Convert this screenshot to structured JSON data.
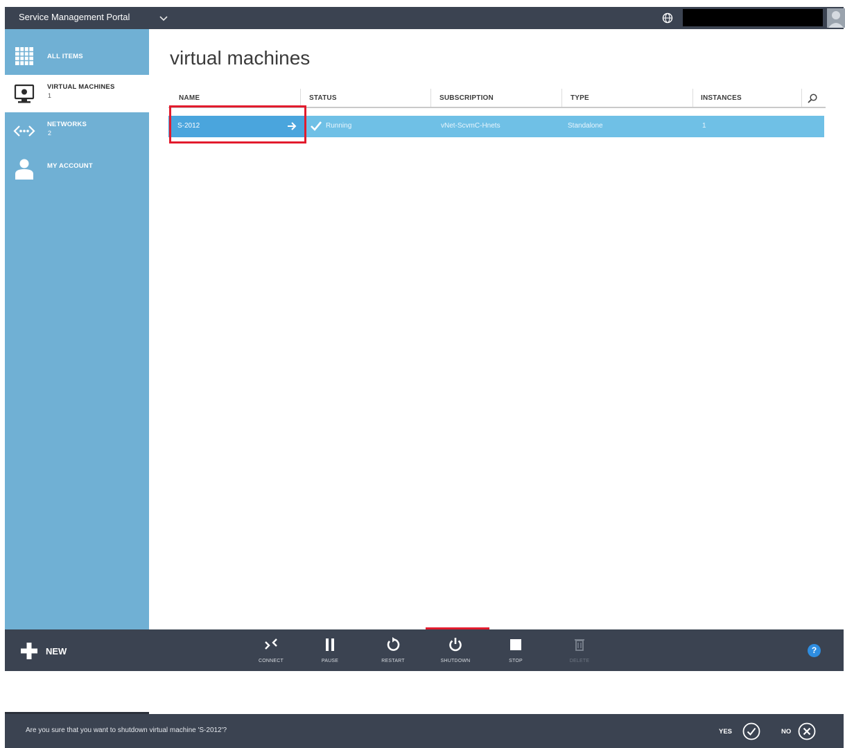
{
  "topbar": {
    "brand": "Service Management Portal",
    "chevron": "chevron-down-icon"
  },
  "sidebar": {
    "items": [
      {
        "label": "ALL ITEMS",
        "count": "",
        "icon": "grid-icon"
      },
      {
        "label": "VIRTUAL MACHINES",
        "count": "1",
        "icon": "monitor-icon",
        "selected": true
      },
      {
        "label": "NETWORKS",
        "count": "2",
        "icon": "network-icon"
      },
      {
        "label": "MY ACCOUNT",
        "count": "",
        "icon": "person-icon"
      }
    ]
  },
  "main": {
    "title": "virtual machines",
    "columns": [
      "NAME",
      "STATUS",
      "SUBSCRIPTION",
      "TYPE",
      "INSTANCES"
    ],
    "rows": [
      {
        "name": "S-2012",
        "status": "Running",
        "subscription": "vNet-ScvmC-Hnets",
        "type": "Standalone",
        "instances": "1"
      }
    ]
  },
  "commandbar": {
    "new_label": "NEW",
    "commands": [
      {
        "label": "CONNECT",
        "icon": "connect-icon",
        "enabled": true
      },
      {
        "label": "PAUSE",
        "icon": "pause-icon",
        "enabled": true
      },
      {
        "label": "RESTART",
        "icon": "restart-icon",
        "enabled": true
      },
      {
        "label": "SHUTDOWN",
        "icon": "power-icon",
        "enabled": true
      },
      {
        "label": "STOP",
        "icon": "stop-icon",
        "enabled": true
      },
      {
        "label": "DELETE",
        "icon": "trash-icon",
        "enabled": false
      }
    ],
    "help": "?"
  },
  "confirm": {
    "message": "Are you sure that you want to shutdown virtual machine 'S-2012'?",
    "yes_label": "YES",
    "no_label": "NO"
  },
  "colors": {
    "accent": "#70b0d4",
    "selected_row": "#6fc0e6",
    "highlight": "#e21b2d",
    "bar": "#3b4351"
  }
}
